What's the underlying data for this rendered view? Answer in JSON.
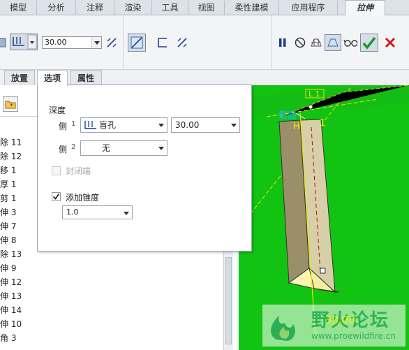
{
  "ribbon": {
    "tabs": [
      "模型",
      "分析",
      "注释",
      "渲染",
      "工具",
      "视图",
      "柔性建模",
      "应用程序"
    ],
    "active_tab": "拉伸"
  },
  "toolbar": {
    "depth_value": "30.00",
    "icons": [
      "solid-icon",
      "blind-depth-icon",
      "flip-direction-icon",
      "remove-material-icon",
      "thicken-icon",
      "flip-thickness-icon",
      "pause-icon",
      "no-preview-icon",
      "geometry-preview-icon",
      "verify-preview-icon",
      "glasses-icon",
      "ok-check-icon",
      "cancel-x-icon"
    ]
  },
  "subtabs": [
    "放置",
    "选项",
    "属性"
  ],
  "active_subtab": "选项",
  "tree": {
    "items": [
      "除 11",
      "除 12",
      "移 1",
      "厚 1",
      "剪 1",
      "伸 3",
      "伸 7",
      "伸 8",
      "除 13",
      "伸 9",
      "伸 12",
      "伸 13",
      "伸 14",
      "伸 10",
      "角 3"
    ]
  },
  "options": {
    "depth_title": "深度",
    "side1_label": "侧",
    "side1_num": "1",
    "side1_type": "盲孔",
    "side1_value": "30.00",
    "side2_label": "侧",
    "side2_num": "2",
    "side2_type": "无",
    "capped_label": "封闭端",
    "taper_label": "添加锥度",
    "taper_checked": true,
    "taper_value": "1.0"
  },
  "viewport": {
    "background_color": "#12c312",
    "label_L1": "L 1",
    "label_section": "截面",
    "label_H": "H",
    "label_1": "1",
    "dim_value": "30.00"
  },
  "watermark": {
    "title": "野火论坛",
    "url": "www.proewildfire.cn"
  }
}
